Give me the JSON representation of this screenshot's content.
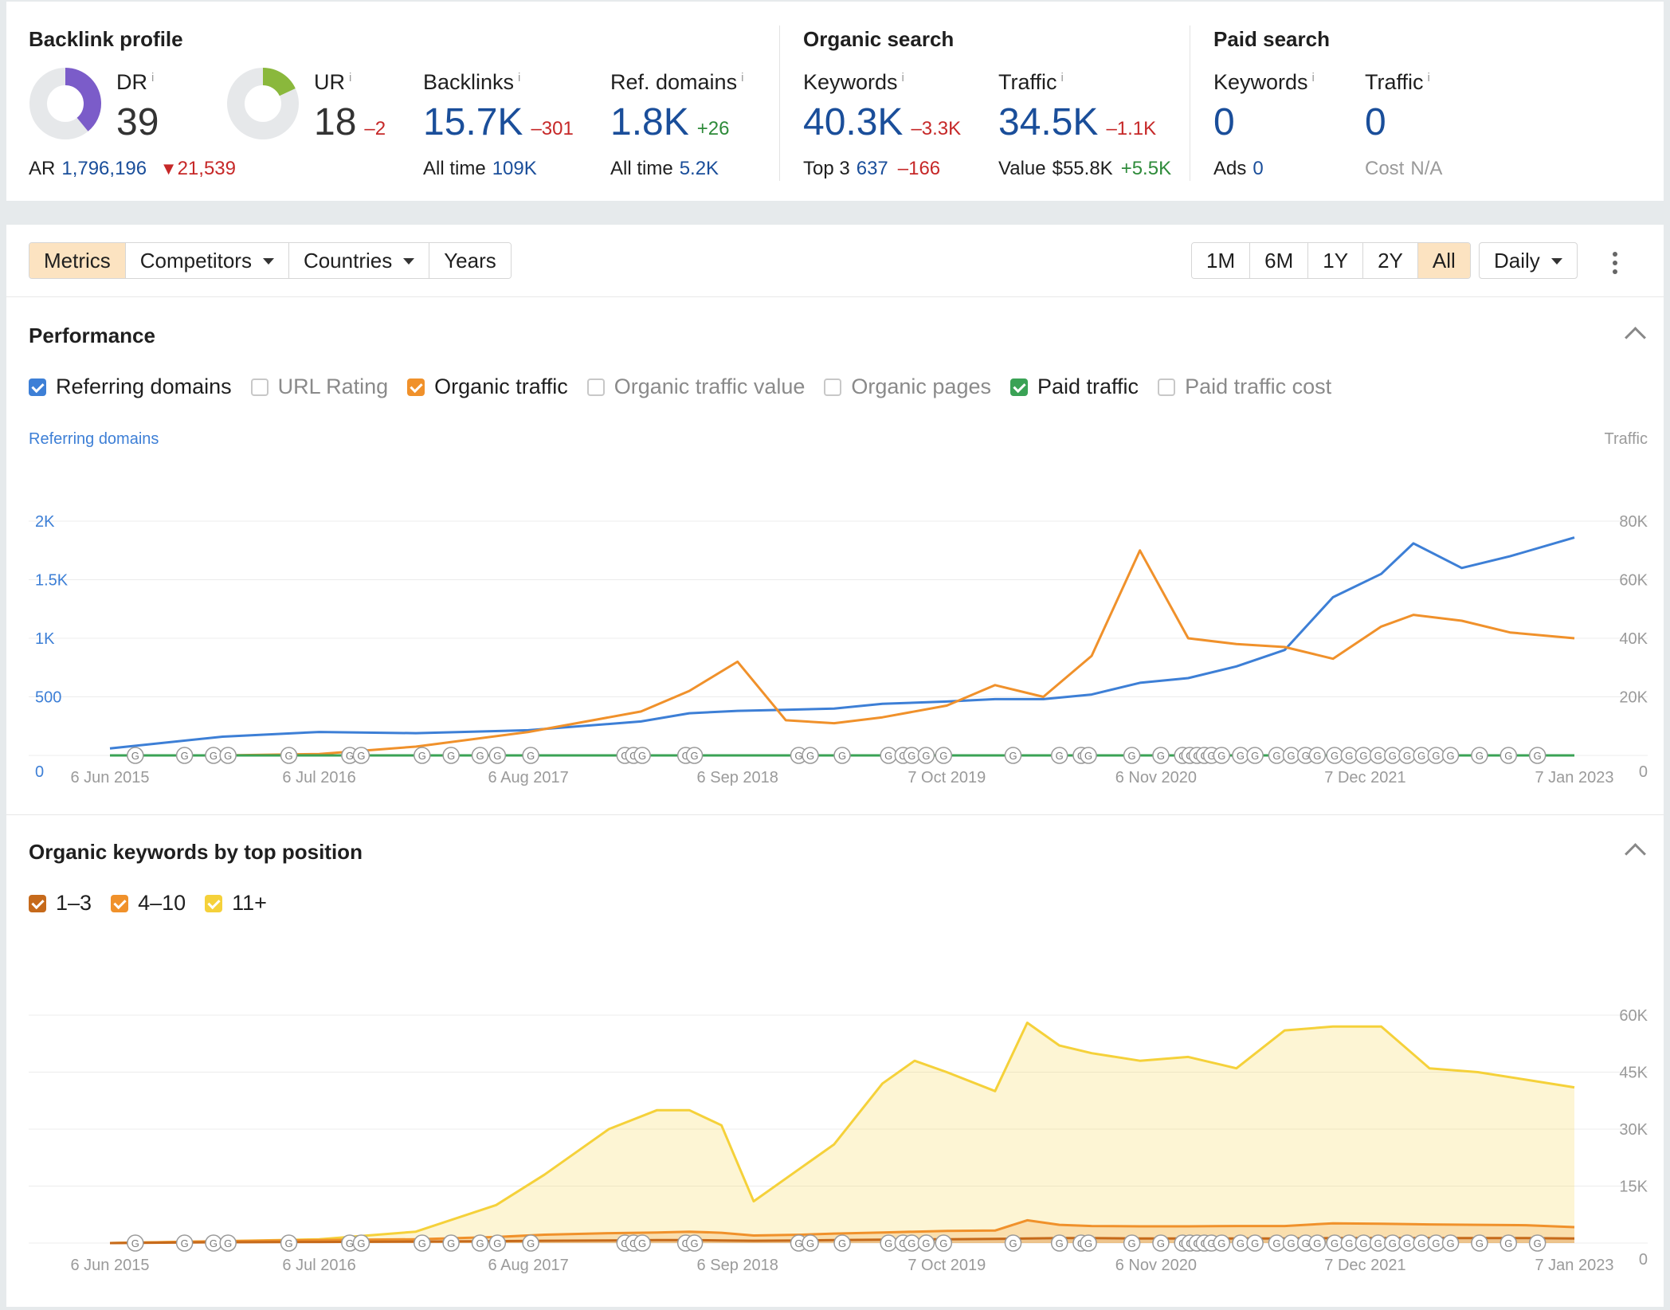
{
  "backlink_profile": {
    "title": "Backlink profile",
    "dr": {
      "label": "DR",
      "value": "39",
      "fraction": 0.39,
      "color": "#7b5cc9"
    },
    "ur": {
      "label": "UR",
      "value": "18",
      "delta": "–2",
      "fraction": 0.18,
      "color": "#8ab83c"
    },
    "ar": {
      "label": "AR",
      "value": "1,796,196",
      "delta": "21,539"
    },
    "backlinks": {
      "label": "Backlinks",
      "value": "15.7K",
      "delta": "–301",
      "sub_label": "All time",
      "sub_value": "109K"
    },
    "ref_domains": {
      "label": "Ref. domains",
      "value": "1.8K",
      "delta": "+26",
      "sub_label": "All time",
      "sub_value": "5.2K"
    },
    "info": "i"
  },
  "organic_search": {
    "title": "Organic search",
    "keywords": {
      "label": "Keywords",
      "value": "40.3K",
      "delta": "–3.3K",
      "sub_label": "Top 3",
      "sub_value": "637",
      "sub_delta": "–166"
    },
    "traffic": {
      "label": "Traffic",
      "value": "34.5K",
      "delta": "–1.1K",
      "sub_label": "Value",
      "sub_value": "$55.8K",
      "sub_delta": "+5.5K"
    }
  },
  "paid_search": {
    "title": "Paid search",
    "keywords": {
      "label": "Keywords",
      "value": "0",
      "sub_label": "Ads",
      "sub_value": "0"
    },
    "traffic": {
      "label": "Traffic",
      "value": "0",
      "sub_label": "Cost",
      "sub_value": "N/A"
    }
  },
  "toolbar": {
    "tabs": [
      {
        "label": "Metrics",
        "active": true
      },
      {
        "label": "Competitors",
        "dropdown": true
      },
      {
        "label": "Countries",
        "dropdown": true
      },
      {
        "label": "Years"
      }
    ],
    "ranges": [
      {
        "label": "1M"
      },
      {
        "label": "6M"
      },
      {
        "label": "1Y"
      },
      {
        "label": "2Y"
      },
      {
        "label": "All",
        "active": true
      }
    ],
    "interval": "Daily",
    "more_icon": "kebab-icon"
  },
  "performance": {
    "title": "Performance",
    "metrics": [
      {
        "label": "Referring domains",
        "checked": true,
        "color": "#3d7fd6"
      },
      {
        "label": "URL Rating",
        "checked": false
      },
      {
        "label": "Organic traffic",
        "checked": true,
        "color": "#f0912b"
      },
      {
        "label": "Organic traffic value",
        "checked": false
      },
      {
        "label": "Organic pages",
        "checked": false
      },
      {
        "label": "Paid traffic",
        "checked": true,
        "color": "#3aa255"
      },
      {
        "label": "Paid traffic cost",
        "checked": false
      }
    ],
    "left_axis_title": "Referring domains",
    "right_axis_title": "Traffic"
  },
  "keywords_section": {
    "title": "Organic keywords by top position",
    "legend": [
      {
        "label": "1–3",
        "color": "#c66a1b"
      },
      {
        "label": "4–10",
        "color": "#f0912b"
      },
      {
        "label": "11+",
        "color": "#f5d13a"
      }
    ]
  },
  "chart_data": [
    {
      "type": "line",
      "x_ticks": [
        "6 Jun 2015",
        "6 Jul 2016",
        "6 Aug 2017",
        "6 Sep 2018",
        "7 Oct 2019",
        "6 Nov 2020",
        "7 Dec 2021",
        "7 Jan 2023"
      ],
      "y_left_ticks": [
        "0",
        "500",
        "1K",
        "1.5K",
        "2K"
      ],
      "y_left_lim": [
        0,
        2000
      ],
      "y_right_ticks": [
        "0",
        "20K",
        "40K",
        "60K",
        "80K"
      ],
      "y_right_lim": [
        0,
        80000
      ],
      "grid": true,
      "x": [
        "2015-06",
        "2016-01",
        "2016-07",
        "2017-01",
        "2017-08",
        "2018-03",
        "2018-06",
        "2018-09",
        "2018-12",
        "2019-03",
        "2019-06",
        "2019-10",
        "2020-01",
        "2020-04",
        "2020-07",
        "2020-10",
        "2021-01",
        "2021-04",
        "2021-07",
        "2021-10",
        "2022-01",
        "2022-03",
        "2022-06",
        "2022-09",
        "2023-01"
      ],
      "series": [
        {
          "name": "Referring domains",
          "axis": "left",
          "color": "#3d7fd6",
          "values": [
            60,
            160,
            200,
            190,
            215,
            290,
            360,
            380,
            390,
            400,
            440,
            460,
            480,
            480,
            520,
            620,
            660,
            760,
            900,
            1350,
            1550,
            1810,
            1600,
            1700,
            1860
          ]
        },
        {
          "name": "Organic traffic",
          "axis": "right",
          "color": "#f0912b",
          "values": [
            0,
            0,
            500,
            3000,
            8000,
            15000,
            22000,
            32000,
            12000,
            11000,
            13000,
            17000,
            24000,
            20000,
            34000,
            70000,
            40000,
            38000,
            37000,
            33000,
            44000,
            48000,
            46000,
            42000,
            40000
          ]
        },
        {
          "name": "Paid traffic",
          "axis": "right",
          "color": "#3aa255",
          "values": [
            0,
            0,
            0,
            0,
            0,
            0,
            0,
            0,
            0,
            0,
            0,
            0,
            0,
            0,
            0,
            0,
            0,
            0,
            0,
            0,
            0,
            0,
            0,
            0,
            0
          ]
        }
      ]
    },
    {
      "type": "area",
      "x_ticks": [
        "6 Jun 2015",
        "6 Jul 2016",
        "6 Aug 2017",
        "6 Sep 2018",
        "7 Oct 2019",
        "6 Nov 2020",
        "7 Dec 2021",
        "7 Jan 2023"
      ],
      "y_ticks": [
        "0",
        "15K",
        "30K",
        "45K",
        "60K"
      ],
      "ylim": [
        0,
        60000
      ],
      "grid": true,
      "x": [
        "2015-06",
        "2016-01",
        "2016-07",
        "2017-01",
        "2017-06",
        "2017-09",
        "2018-01",
        "2018-04",
        "2018-06",
        "2018-08",
        "2018-10",
        "2019-01",
        "2019-03",
        "2019-06",
        "2019-08",
        "2019-10",
        "2020-01",
        "2020-03",
        "2020-05",
        "2020-07",
        "2020-10",
        "2021-01",
        "2021-04",
        "2021-07",
        "2021-10",
        "2022-01",
        "2022-04",
        "2022-07",
        "2022-10",
        "2023-01"
      ],
      "series": [
        {
          "name": "1–3",
          "color": "#c66a1b",
          "values": [
            0,
            200,
            300,
            400,
            500,
            600,
            700,
            800,
            800,
            700,
            600,
            700,
            800,
            900,
            1000,
            1000,
            1100,
            1200,
            1300,
            1300,
            1200,
            1200,
            1200,
            1200,
            1300,
            1300,
            1300,
            1300,
            1300,
            1200
          ]
        },
        {
          "name": "4–10",
          "color": "#f0912b",
          "values": [
            0,
            500,
            800,
            1000,
            1600,
            2200,
            2600,
            2800,
            3000,
            2700,
            2000,
            2200,
            2500,
            2800,
            3000,
            3200,
            3300,
            6000,
            4800,
            4500,
            4400,
            4400,
            4500,
            4500,
            5200,
            5100,
            4900,
            4800,
            4700,
            4200
          ]
        },
        {
          "name": "11+",
          "color": "#f5d13a",
          "values": [
            0,
            500,
            1000,
            3000,
            10000,
            18000,
            30000,
            35000,
            35000,
            31000,
            11000,
            20000,
            26000,
            42000,
            48000,
            45000,
            40000,
            58000,
            52000,
            50000,
            48000,
            49000,
            46000,
            56000,
            57000,
            57000,
            46000,
            45000,
            43000,
            41000
          ]
        }
      ]
    }
  ]
}
